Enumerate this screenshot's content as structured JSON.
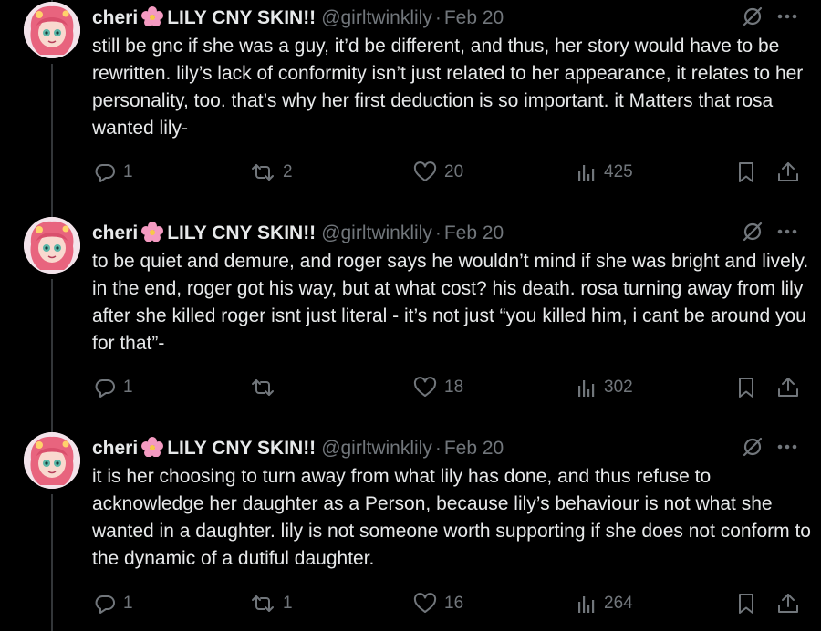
{
  "colors": {
    "background": "#000000",
    "text": "#e7e9ea",
    "muted": "#71767b",
    "thread_line": "#333639",
    "flower": "#f49ac1"
  },
  "icons": {
    "grok": "grok-slash-icon",
    "more": "more-dots-icon",
    "reply": "reply-bubble-icon",
    "retweet": "retweet-icon",
    "like": "heart-icon",
    "views": "views-bars-icon",
    "bookmark": "bookmark-icon",
    "share": "share-upload-icon"
  },
  "tweets": [
    {
      "author_name": "cheri",
      "author_name_suffix": "LILY CNY SKIN!!",
      "handle": "@girltwinklily",
      "dot": "·",
      "date": "Feb 20",
      "text": "still be gnc if she was a guy, it’d be different, and thus, her story would have to be rewritten. lily’s lack of conformity isn’t just related to her appearance, it relates to her personality, too. that’s why her first deduction is so important. it Matters that rosa wanted lily-",
      "replies": "1",
      "retweets": "2",
      "likes": "20",
      "views": "425"
    },
    {
      "author_name": "cheri",
      "author_name_suffix": "LILY CNY SKIN!!",
      "handle": "@girltwinklily",
      "dot": "·",
      "date": "Feb 20",
      "text": "to be quiet and demure, and roger says he wouldn’t mind if she was bright and lively. in the end, roger got his way, but at what cost? his death. rosa turning away from lily after she killed roger isnt just literal - it’s not just “you killed him, i cant be around you for that”-",
      "replies": "1",
      "retweets": "",
      "likes": "18",
      "views": "302"
    },
    {
      "author_name": "cheri",
      "author_name_suffix": "LILY CNY SKIN!!",
      "handle": "@girltwinklily",
      "dot": "·",
      "date": "Feb 20",
      "text": "it is her choosing to turn away from what lily has done, and thus refuse to acknowledge her daughter as a Person, because lily’s behaviour is not what she wanted in a daughter. lily is not someone worth supporting if she does not conform to the dynamic of a dutiful daughter.",
      "replies": "1",
      "retweets": "1",
      "likes": "16",
      "views": "264"
    }
  ]
}
